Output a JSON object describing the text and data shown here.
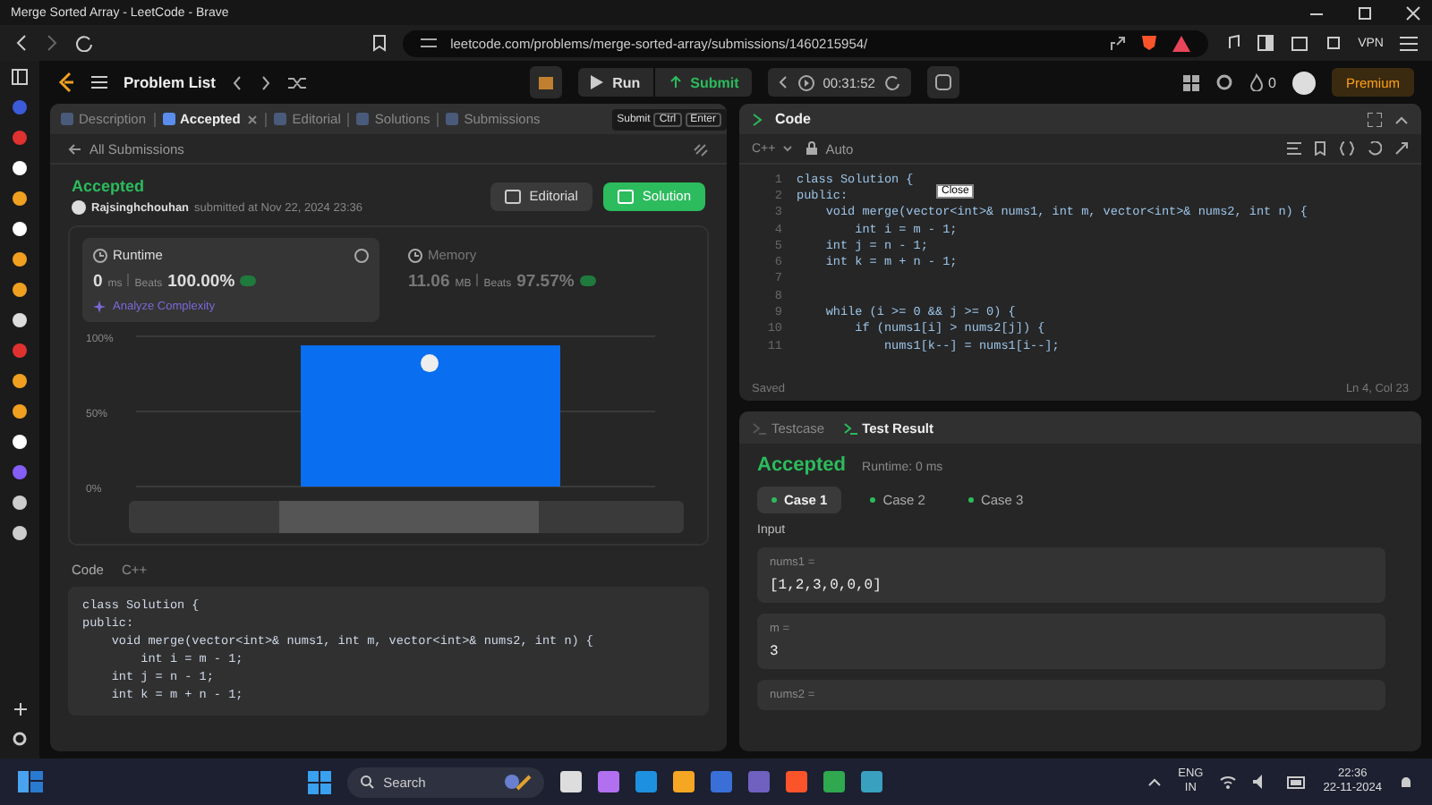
{
  "window": {
    "title": "Merge Sorted Array - LeetCode - Brave"
  },
  "browser": {
    "url": "leetcode.com/problems/merge-sorted-array/submissions/1460215954/",
    "vpn": "VPN"
  },
  "topbar": {
    "problem_list": "Problem List",
    "run": "Run",
    "submit": "Submit",
    "timer": "00:31:52",
    "streak": "0",
    "premium": "Premium"
  },
  "left_panel": {
    "tabs": [
      {
        "label": "Description",
        "selected": false
      },
      {
        "label": "Accepted",
        "selected": true
      },
      {
        "label": "Editorial",
        "selected": false
      },
      {
        "label": "Solutions",
        "selected": false
      },
      {
        "label": "Submissions",
        "selected": false
      }
    ],
    "shortcut_hint": {
      "label": "Submit",
      "keys": [
        "Ctrl",
        "Enter"
      ]
    },
    "back_link": "All Submissions",
    "status": "Accepted",
    "author": "Rajsinghchouhan",
    "submitted": "submitted at Nov 22, 2024 23:36",
    "buttons": [
      {
        "label": "Editorial",
        "kind": "secondary"
      },
      {
        "label": "Solution",
        "kind": "primary"
      }
    ],
    "metrics": [
      {
        "title": "Runtime",
        "value": "0",
        "unit": "ms",
        "beats_label": "Beats",
        "beats": "100.00%",
        "selected": true,
        "link": "Analyze Complexity"
      },
      {
        "title": "Memory",
        "value": "11.06",
        "unit": "MB",
        "beats_label": "Beats",
        "beats": "97.57%",
        "selected": false
      }
    ],
    "range_slider": {
      "level": 0.47
    },
    "chart_data": {
      "type": "bar",
      "values": [
        94
      ],
      "ylim": [
        0,
        100
      ],
      "yticks": [
        {
          "value": 0,
          "label": "0%"
        },
        {
          "value": 50,
          "label": "50%"
        },
        {
          "value": 100,
          "label": "100%"
        }
      ]
    },
    "code_label": "Code",
    "language": "C++",
    "code": [
      "class Solution {",
      "public:",
      "    void merge(vector<int>& nums1, int m, vector<int>& nums2, int n) {",
      "        int i = m - 1;",
      "    int j = n - 1;",
      "    int k = m + n - 1;"
    ]
  },
  "editor": {
    "title": "Code",
    "language": "C++",
    "mode": "Auto",
    "tooltip": "Close",
    "lines": [
      {
        "number": "1",
        "text": "class Solution {"
      },
      {
        "number": "2",
        "text": "public:"
      },
      {
        "number": "3",
        "text": "    void merge(vector<int>& nums1, int m, vector<int>& nums2, int n) {"
      },
      {
        "number": "4",
        "text": "        int i = m - 1;"
      },
      {
        "number": "5",
        "text": "    int j = n - 1;"
      },
      {
        "number": "6",
        "text": "    int k = m + n - 1;"
      },
      {
        "number": "7"
      },
      {
        "number": "8"
      },
      {
        "number": "9",
        "text": "    while (i >= 0 && j >= 0) {"
      },
      {
        "number": "10",
        "text": "        if (nums1[i] > nums2[j]) {"
      },
      {
        "number": "11",
        "text": "            nums1[k--] = nums1[i--];"
      }
    ],
    "status": "Saved",
    "cursor": "Ln 4, Col 23"
  },
  "result": {
    "tabs": [
      {
        "label": "Testcase",
        "selected": false
      },
      {
        "label": "Test Result",
        "selected": true
      }
    ],
    "status": "Accepted",
    "runtime": "Runtime: 0 ms",
    "cases": [
      {
        "label": "Case 1",
        "selected": true
      },
      {
        "label": "Case 2",
        "selected": false
      },
      {
        "label": "Case 3",
        "selected": false
      }
    ],
    "input_label": "Input",
    "params": [
      {
        "name": "nums1 =",
        "value": "[1,2,3,0,0,0]"
      },
      {
        "name": "m =",
        "value": "3"
      },
      {
        "name": "nums2 ="
      }
    ]
  },
  "taskbar": {
    "search": "Search",
    "language": "ENG",
    "region": "IN",
    "time": "22:36",
    "date": "22-11-2024"
  }
}
